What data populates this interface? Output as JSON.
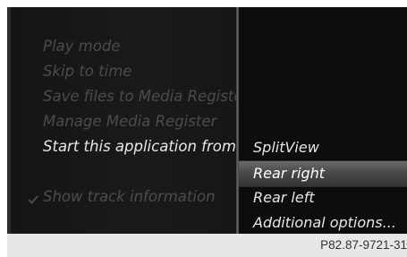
{
  "menu": {
    "items": [
      {
        "label": "Play mode"
      },
      {
        "label": "Skip to time"
      },
      {
        "label": "Save files to Media Register"
      },
      {
        "label": "Manage Media Register"
      },
      {
        "label": "Start this application from a"
      },
      {
        "label": "Show track information"
      }
    ]
  },
  "submenu": {
    "items": [
      {
        "label": "SplitView"
      },
      {
        "label": "Rear right"
      },
      {
        "label": "Rear left"
      },
      {
        "label": "Additional options..."
      }
    ]
  },
  "caption": "P82.87-9721-31"
}
